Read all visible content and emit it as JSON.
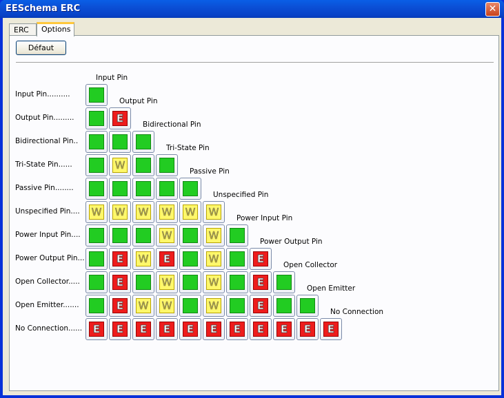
{
  "window": {
    "title": "EESchema ERC"
  },
  "tabs": [
    {
      "label": "ERC"
    },
    {
      "label": "Options"
    }
  ],
  "options": {
    "default_button": "Défaut",
    "row_labels": [
      "Input Pin..........",
      "Output Pin.........",
      "Bidirectional Pin..",
      "Tri-State Pin......",
      "Passive Pin........",
      "Unspecified Pin....",
      "Power Input Pin....",
      "Power Output Pin...",
      "Open Collector.....",
      "Open Emitter.......",
      "No Connection......"
    ],
    "column_labels": [
      "Input Pin",
      "Output Pin",
      "Bidirectional Pin",
      "Tri-State Pin",
      "Passive Pin",
      "Unspecified Pin",
      "Power Input Pin",
      "Power Output Pin",
      "Open Collector",
      "Open Emitter",
      "No Connection"
    ],
    "matrix": [
      [
        "ok"
      ],
      [
        "ok",
        "err"
      ],
      [
        "ok",
        "ok",
        "ok"
      ],
      [
        "ok",
        "warn",
        "ok",
        "ok"
      ],
      [
        "ok",
        "ok",
        "ok",
        "ok",
        "ok"
      ],
      [
        "warn",
        "warn",
        "warn",
        "warn",
        "warn",
        "warn"
      ],
      [
        "ok",
        "ok",
        "ok",
        "warn",
        "ok",
        "warn",
        "ok"
      ],
      [
        "ok",
        "err",
        "warn",
        "err",
        "ok",
        "warn",
        "ok",
        "err"
      ],
      [
        "ok",
        "err",
        "ok",
        "warn",
        "ok",
        "warn",
        "ok",
        "err",
        "ok"
      ],
      [
        "ok",
        "err",
        "warn",
        "warn",
        "ok",
        "warn",
        "ok",
        "err",
        "ok",
        "ok"
      ],
      [
        "err",
        "err",
        "err",
        "err",
        "err",
        "err",
        "err",
        "err",
        "err",
        "err",
        "err"
      ]
    ],
    "mark_text": {
      "ok": "",
      "warn": "W",
      "err": "E"
    }
  },
  "colors": {
    "ok": "#22cc22",
    "warn": "#fff86a",
    "err": "#ee1c1c"
  }
}
